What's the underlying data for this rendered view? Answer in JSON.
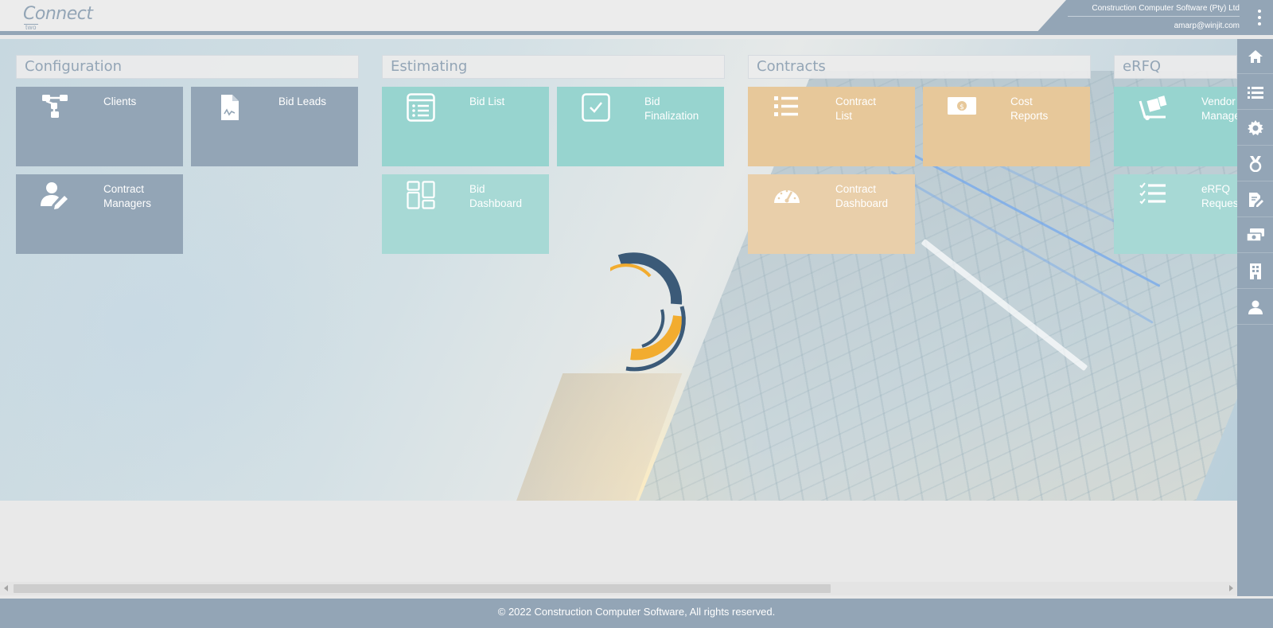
{
  "header": {
    "logo_word": "Connect",
    "logo_sub": "two",
    "company": "Construction Computer Software (Pty) Ltd",
    "user_email": "amarp@winjit.com"
  },
  "sections": {
    "configuration": {
      "title": "Configuration",
      "tiles": {
        "clients": "Clients",
        "bid_leads": "Bid Leads",
        "contract_managers_1": "Contract",
        "contract_managers_2": "Managers"
      }
    },
    "estimating": {
      "title": "Estimating",
      "tiles": {
        "bid_list": "Bid List",
        "bid_finalization_1": "Bid",
        "bid_finalization_2": "Finalization",
        "bid_dashboard_1": "Bid",
        "bid_dashboard_2": "Dashboard"
      }
    },
    "contracts": {
      "title": "Contracts",
      "tiles": {
        "contract_list_1": "Contract",
        "contract_list_2": "List",
        "cost_reports_1": "Cost",
        "cost_reports_2": "Reports",
        "contract_dashboard_1": "Contract",
        "contract_dashboard_2": "Dashboard"
      }
    },
    "erfq": {
      "title": "eRFQ",
      "tiles": {
        "vendor_1": "Vendor",
        "vendor_2": "Manage",
        "erfq_requests_1": "eRFQ",
        "erfq_requests_2": "Reques"
      }
    }
  },
  "sidebar": {
    "icons": [
      "home-icon",
      "list-icon",
      "gear-icon",
      "medal-icon",
      "edit-document-icon",
      "money-transfer-icon",
      "building-icon",
      "user-icon"
    ]
  },
  "footer": {
    "copyright": "© 2022 Construction Computer Software, All rights reserved."
  },
  "colors": {
    "slate": "#93a5b6",
    "teal": "#97d4cf",
    "sand": "#e7c89a",
    "spinner_navy": "#3b5a78",
    "spinner_orange": "#f2ac2f"
  }
}
